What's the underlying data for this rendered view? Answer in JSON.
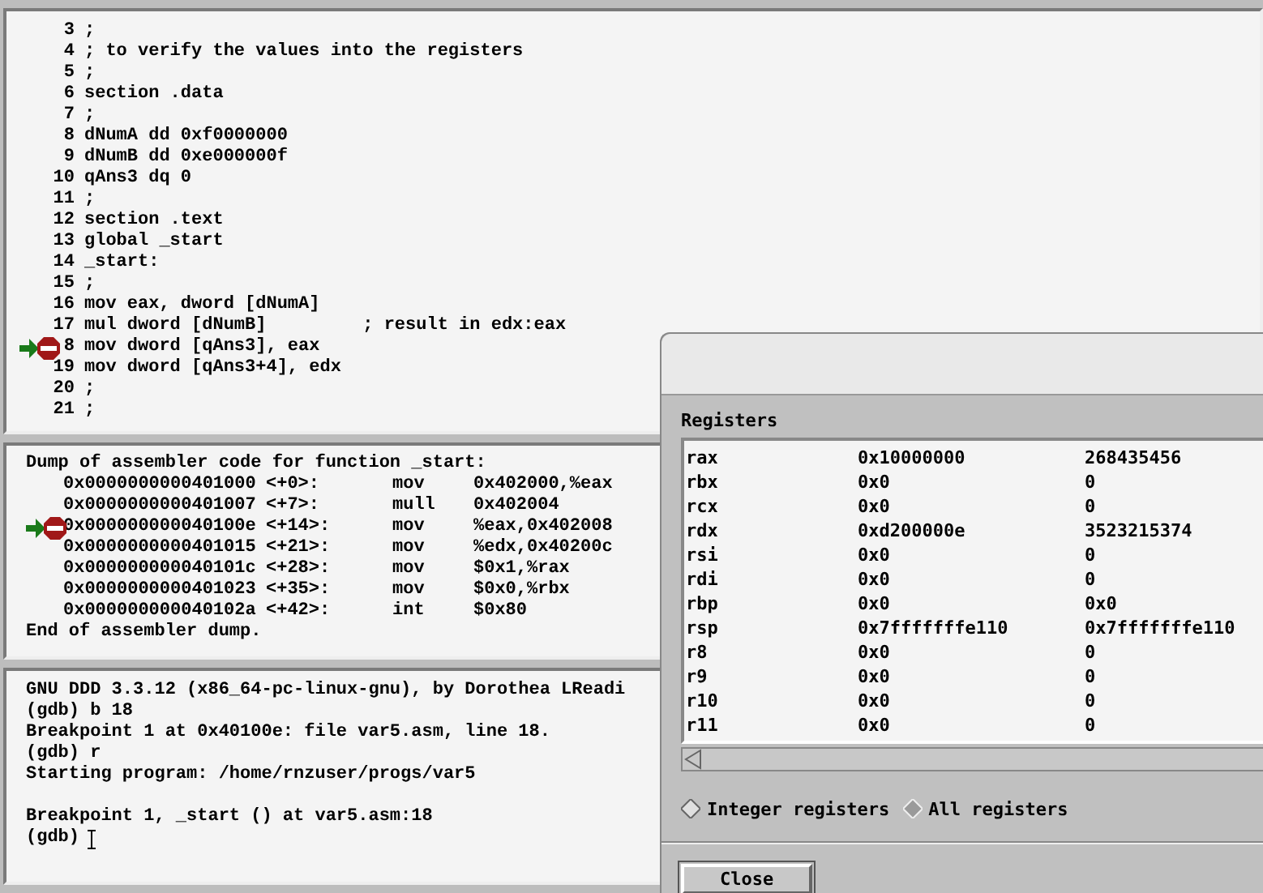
{
  "source": {
    "lines": [
      {
        "number": "3",
        "text": ";",
        "breakpoint": false,
        "current": false
      },
      {
        "number": "4",
        "text": "; to verify the values into the registers",
        "breakpoint": false,
        "current": false
      },
      {
        "number": "5",
        "text": ";",
        "breakpoint": false,
        "current": false
      },
      {
        "number": "6",
        "text": "section .data",
        "breakpoint": false,
        "current": false
      },
      {
        "number": "7",
        "text": ";",
        "breakpoint": false,
        "current": false
      },
      {
        "number": "8",
        "text": "dNumA dd 0xf0000000",
        "breakpoint": false,
        "current": false
      },
      {
        "number": "9",
        "text": "dNumB dd 0xe000000f",
        "breakpoint": false,
        "current": false
      },
      {
        "number": "10",
        "text": "qAns3 dq 0",
        "breakpoint": false,
        "current": false
      },
      {
        "number": "11",
        "text": ";",
        "breakpoint": false,
        "current": false
      },
      {
        "number": "12",
        "text": "section .text",
        "breakpoint": false,
        "current": false
      },
      {
        "number": "13",
        "text": "global _start",
        "breakpoint": false,
        "current": false
      },
      {
        "number": "14",
        "text": "_start:",
        "breakpoint": false,
        "current": false
      },
      {
        "number": "15",
        "text": ";",
        "breakpoint": false,
        "current": false
      },
      {
        "number": "16",
        "text": "mov eax, dword [dNumA]",
        "breakpoint": false,
        "current": false
      },
      {
        "number": "17",
        "text": "mul dword [dNumB]         ; result in edx:eax",
        "breakpoint": false,
        "current": false
      },
      {
        "number": "8",
        "text": "mov dword [qAns3], eax",
        "breakpoint": true,
        "current": true
      },
      {
        "number": "19",
        "text": "mov dword [qAns3+4], edx",
        "breakpoint": false,
        "current": false
      },
      {
        "number": "20",
        "text": ";",
        "breakpoint": false,
        "current": false
      },
      {
        "number": "21",
        "text": ";",
        "breakpoint": false,
        "current": false
      }
    ]
  },
  "disassembly": {
    "header": "Dump of assembler code for function _start:",
    "rows": [
      {
        "address": "0x0000000000401000",
        "offset": "<+0>:",
        "mnemonic": "mov",
        "operands": "0x402000,%eax",
        "breakpoint": false,
        "current": false
      },
      {
        "address": "0x0000000000401007",
        "offset": "<+7>:",
        "mnemonic": "mull",
        "operands": "0x402004",
        "breakpoint": false,
        "current": false
      },
      {
        "address": "0x000000000040100e",
        "offset": "<+14>:",
        "mnemonic": "mov",
        "operands": "%eax,0x402008",
        "breakpoint": true,
        "current": true
      },
      {
        "address": "0x0000000000401015",
        "offset": "<+21>:",
        "mnemonic": "mov",
        "operands": "%edx,0x40200c",
        "breakpoint": false,
        "current": false
      },
      {
        "address": "0x000000000040101c",
        "offset": "<+28>:",
        "mnemonic": "mov",
        "operands": "$0x1,%rax",
        "breakpoint": false,
        "current": false
      },
      {
        "address": "0x0000000000401023",
        "offset": "<+35>:",
        "mnemonic": "mov",
        "operands": "$0x0,%rbx",
        "breakpoint": false,
        "current": false
      },
      {
        "address": "0x000000000040102a",
        "offset": "<+42>:",
        "mnemonic": "int",
        "operands": "$0x80",
        "breakpoint": false,
        "current": false
      }
    ],
    "footer": "End of assembler dump."
  },
  "console": {
    "blocks": [
      {
        "lines": [
          {
            "text": "GNU DDD 3.3.12 (x86_64-pc-linux-gnu), by Dorothea LReadi",
            "cursor": false
          },
          {
            "text": "(gdb) b 18",
            "cursor": false
          },
          {
            "text": "Breakpoint 1 at 0x40100e: file var5.asm, line 18.",
            "cursor": false
          },
          {
            "text": "(gdb) r",
            "cursor": false
          },
          {
            "text": "Starting program: /home/rnzuser/progs/var5",
            "cursor": false
          }
        ]
      },
      {
        "lines": [
          {
            "text": "Breakpoint 1, _start () at var5.asm:18",
            "cursor": false
          },
          {
            "text": "(gdb)",
            "cursor": true
          }
        ]
      }
    ]
  },
  "registers_dialog": {
    "label": "Registers",
    "rows": [
      {
        "name": "rax",
        "hex": "0x10000000",
        "value": "268435456"
      },
      {
        "name": "rbx",
        "hex": "0x0",
        "value": "0"
      },
      {
        "name": "rcx",
        "hex": "0x0",
        "value": "0"
      },
      {
        "name": "rdx",
        "hex": "0xd200000e",
        "value": "3523215374"
      },
      {
        "name": "rsi",
        "hex": "0x0",
        "value": "0"
      },
      {
        "name": "rdi",
        "hex": "0x0",
        "value": "0"
      },
      {
        "name": "rbp",
        "hex": "0x0",
        "value": "0x0"
      },
      {
        "name": "rsp",
        "hex": "0x7fffffffe110",
        "value": "0x7fffffffe110"
      },
      {
        "name": "r8",
        "hex": "0x0",
        "value": "0"
      },
      {
        "name": "r9",
        "hex": "0x0",
        "value": "0"
      },
      {
        "name": "r10",
        "hex": "0x0",
        "value": "0"
      },
      {
        "name": "r11",
        "hex": "0x0",
        "value": "0"
      }
    ],
    "options": [
      {
        "label": "Integer registers",
        "selected": false
      },
      {
        "label": "All registers",
        "selected": true
      }
    ],
    "buttons": [
      "Close"
    ]
  }
}
